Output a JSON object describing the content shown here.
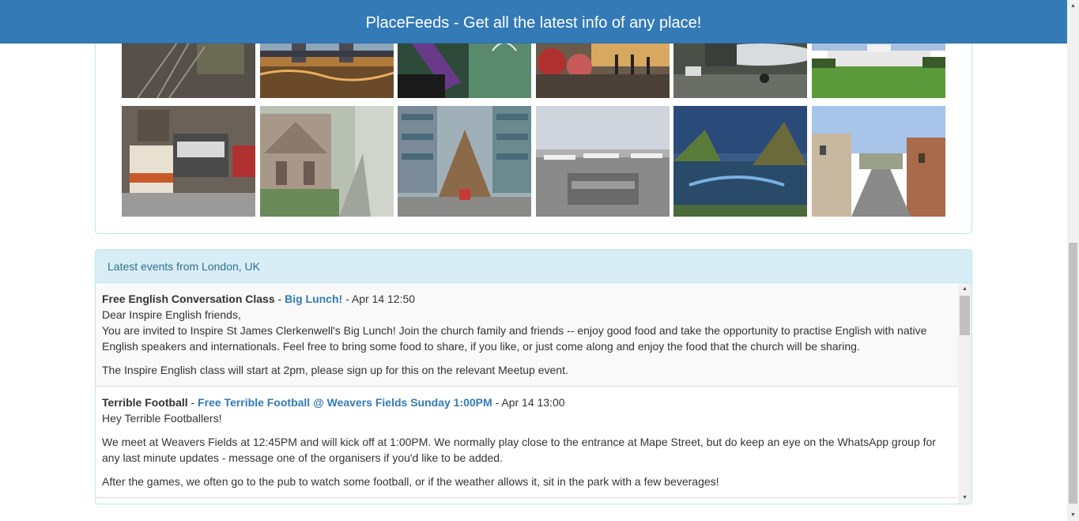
{
  "header": {
    "title": "PlaceFeeds - Get all the latest info of any place!"
  },
  "photos": [
    {
      "name": "photo-train-tracks",
      "alt": "train tracks"
    },
    {
      "name": "photo-tower-bridge",
      "alt": "tower bridge"
    },
    {
      "name": "photo-graffiti-wall",
      "alt": "graffiti"
    },
    {
      "name": "photo-street-sculptures",
      "alt": "sculptures"
    },
    {
      "name": "photo-airplane",
      "alt": "airplane"
    },
    {
      "name": "photo-greenwich",
      "alt": "park building"
    },
    {
      "name": "photo-model-buses",
      "alt": "model buses"
    },
    {
      "name": "photo-church-street",
      "alt": "church"
    },
    {
      "name": "photo-boat-shelter",
      "alt": "boat shelter"
    },
    {
      "name": "photo-airport-view",
      "alt": "airport"
    },
    {
      "name": "photo-pond-trees",
      "alt": "pond"
    },
    {
      "name": "photo-street-view",
      "alt": "street"
    }
  ],
  "events": {
    "heading": "Latest events from London, UK",
    "items": [
      {
        "group": "Free English Conversation Class",
        "sep1": " - ",
        "event": "Big Lunch!",
        "sep2": " - ",
        "time": "Apr 14 12:50",
        "line1": "Dear Inspire English friends,",
        "line2": "You are invited to Inspire St James Clerkenwell's Big Lunch! Join the church family and friends -- enjoy good food and take the opportunity to practise English with native English speakers and internationals. Feel free to bring some food to share, if you like, or just come along and enjoy the food that the church will be sharing.",
        "line3": "The Inspire English class will start at 2pm, please sign up for this on the relevant Meetup event."
      },
      {
        "group": "Terrible Football",
        "sep1": " - ",
        "event": "Free Terrible Football @ Weavers Fields Sunday 1:00PM",
        "sep2": " - ",
        "time": "Apr 14 13:00",
        "line1": "Hey Terrible Footballers!",
        "line2": "We meet at Weavers Fields at 12:45PM and will kick off at 1:00PM. We normally play close to the entrance at Mape Street, but do keep an eye on the WhatsApp group for any last minute updates - message one of the organisers if you'd like to be added.",
        "line3": "After the games, we often go to the pub to watch some football, or if the weather allows it, sit in the park with a few beverages!"
      }
    ]
  }
}
